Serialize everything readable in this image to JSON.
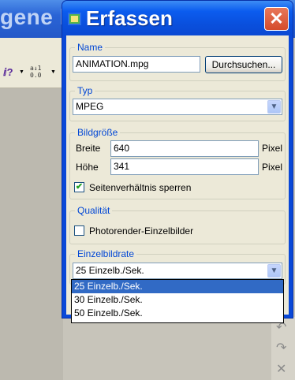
{
  "background_app": {
    "title_fragment": "gene l"
  },
  "dialog": {
    "title": "Erfassen",
    "close_glyph": "✕",
    "name_group": {
      "legend": "Name",
      "filename": "ANIMATION.mpg",
      "browse_label": "Durchsuchen..."
    },
    "type_group": {
      "legend": "Typ",
      "selected": "MPEG"
    },
    "size_group": {
      "legend": "Bildgröße",
      "width_label": "Breite",
      "width_value": "640",
      "width_unit": "Pixel",
      "height_label": "Höhe",
      "height_value": "341",
      "height_unit": "Pixel",
      "lock_aspect_label": "Seitenverhältnis sperren",
      "lock_aspect_checked": true
    },
    "quality_group": {
      "legend": "Qualität",
      "photorender_label": "Photorender-Einzelbilder",
      "photorender_checked": false
    },
    "framerate_group": {
      "legend": "Einzelbildrate",
      "selected": "25 Einzelb./Sek.",
      "options": [
        "25 Einzelb./Sek.",
        "30 Einzelb./Sek.",
        "50 Einzelb./Sek."
      ]
    }
  },
  "icons": {
    "help": "?",
    "sort": "A↓",
    "undo": "↶",
    "redo": "↷",
    "delete": "✕",
    "dropdown_arrow": "⌄"
  },
  "colors": {
    "title_bar": "#0a4fdc",
    "close_button": "#d54b2a",
    "group_legend": "#0046d5",
    "selection": "#316ac5"
  }
}
